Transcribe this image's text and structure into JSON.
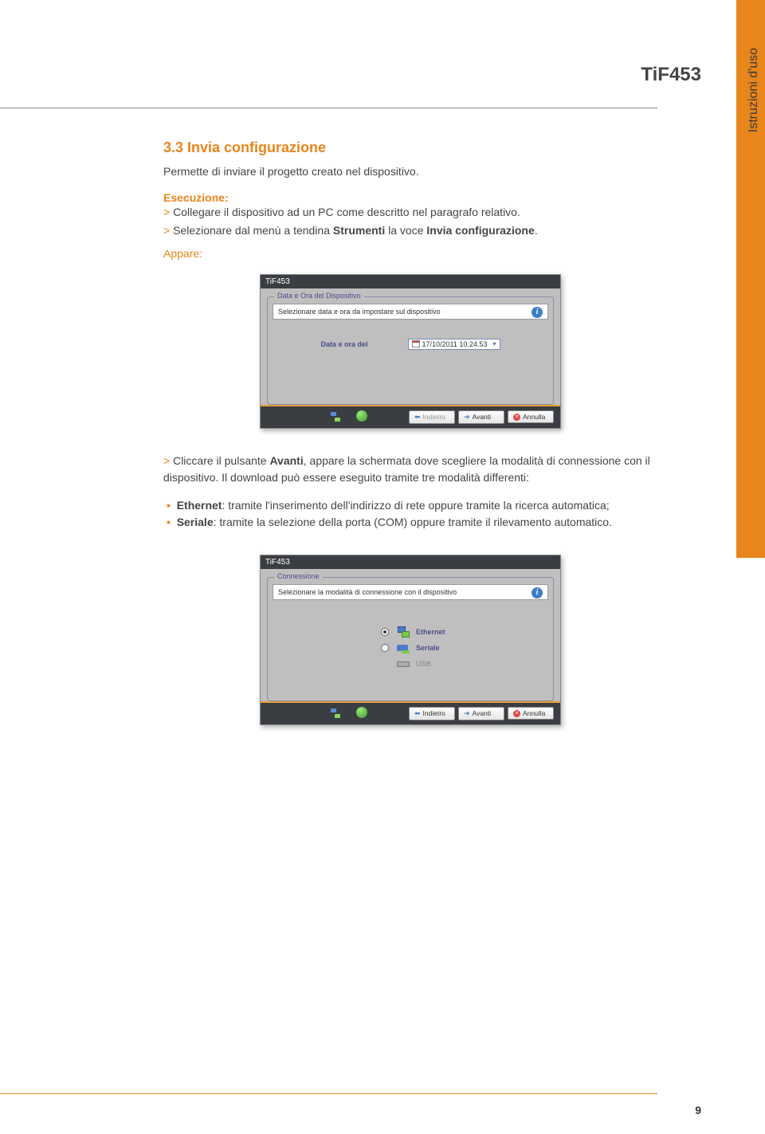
{
  "sidebar_label": "Istruzioni d'uso",
  "product_code": "TiF453",
  "page_number": "9",
  "section": {
    "title": "3.3 Invia configurazione",
    "intro": "Permette di inviare il progetto creato nel dispositivo.",
    "exec_label": "Esecuzione:",
    "step1_pre": "Collegare il dispositivo ad un PC come descritto nel paragrafo relativo.",
    "step2_pre": "Selezionare dal menù a tendina ",
    "step2_bold": "Strumenti",
    "step2_mid": " la voce ",
    "step2_bold2": "Invia configurazione",
    "step2_post": ".",
    "appare": "Appare:"
  },
  "shot1": {
    "title": "TiF453",
    "group_label": "Data e Ora del Dispositivo",
    "info_text": "Selezionare data e ora da impostare sul dispositivo",
    "date_label": "Data e ora del",
    "date_value": "17/10/2011 10.24.53",
    "btn_back": "Indietro",
    "btn_next": "Avanti",
    "btn_cancel": "Annulla"
  },
  "after1": {
    "step_pre": "Cliccare il pulsante ",
    "step_bold": "Avanti",
    "step_post": ", appare la schermata dove scegliere la modalità di connessione con il dispositivo. Il download può essere eseguito tramite tre modalità differenti:",
    "bullet1_bold": "Ethernet",
    "bullet1_text": ": tramite l'inserimento dell'indirizzo di rete oppure tramite la ricerca automatica;",
    "bullet2_bold": "Seriale",
    "bullet2_text": ": tramite la selezione della porta (COM) oppure tramite il rilevamento automatico."
  },
  "shot2": {
    "title": "TiF453",
    "group_label": "Connessione",
    "info_text": "Selezionare la modalità di connessione con il dispositivo",
    "opt1": "Ethernet",
    "opt2": "Seriale",
    "opt3": "USB",
    "btn_back": "Indietro",
    "btn_next": "Avanti",
    "btn_cancel": "Annulla"
  }
}
